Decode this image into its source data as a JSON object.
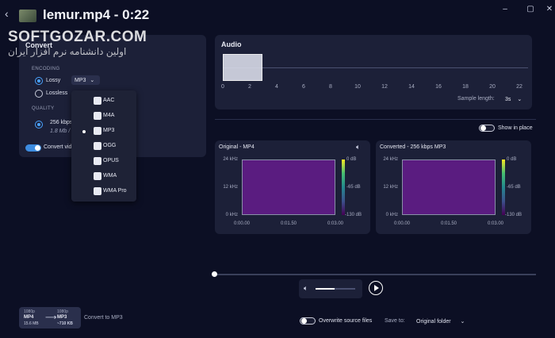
{
  "window": {
    "title": "lemur.mp4 - 0:22",
    "minimize": "–",
    "maximize": "▢",
    "close": "✕"
  },
  "watermark": {
    "main": "SOFTGOZAR.COM",
    "sub": "اولین دانشنامه نرم افزار ایران"
  },
  "convert": {
    "title": "Convert",
    "encoding_label": "ENCODING",
    "lossy_label": "Lossy",
    "lossless_label": "Lossless",
    "format_value": "MP3",
    "quality_label": "QUALITY",
    "quality_value": "256 kbps",
    "quality_size": "1.8 Mb /",
    "convert_video_label": "Convert vid"
  },
  "format_menu": [
    {
      "label": "AAC",
      "icon": "aac-icon",
      "selected": false
    },
    {
      "label": "M4A",
      "icon": "m4a-icon",
      "selected": false
    },
    {
      "label": "MP3",
      "icon": "mp3-icon",
      "selected": true
    },
    {
      "label": "OGG",
      "icon": "ogg-icon",
      "selected": false
    },
    {
      "label": "OPUS",
      "icon": "opus-icon",
      "selected": false
    },
    {
      "label": "WMA",
      "icon": "wma-icon",
      "selected": false
    },
    {
      "label": "WMA Pro",
      "icon": "wma-pro-icon",
      "selected": false
    }
  ],
  "audio": {
    "title": "Audio",
    "ticks": [
      "0",
      "2",
      "4",
      "6",
      "8",
      "10",
      "12",
      "14",
      "16",
      "18",
      "20",
      "22"
    ],
    "sample_length_label": "Sample length:",
    "sample_length_value": "3s",
    "show_in_place_label": "Show in place"
  },
  "spectrograms": {
    "original_title": "Original - MP4",
    "converted_title": "Converted - 256 kbps MP3",
    "y_labels": [
      "24 kHz",
      "12 kHz",
      "0 kHz"
    ],
    "x_labels": [
      "0:00.00",
      "0:01.50",
      "0:03.00"
    ],
    "db_labels": [
      "0 dB",
      "-65 dB",
      "-130 dB"
    ]
  },
  "summary": {
    "from_res": "1080p",
    "from_fmt": "MP4",
    "from_size": "15.6 MB",
    "to_res": "1080p",
    "to_fmt": "MP3",
    "to_size": "~710 KB",
    "convert_to": "Convert to MP3"
  },
  "footer": {
    "overwrite_label": "Overwrite source files",
    "save_to_label": "Save to:",
    "save_to_value": "Original folder"
  },
  "colors": {
    "accent": "#3d8ce0",
    "background": "#0c0f24",
    "panel": "#1c2038",
    "spectrogram_fill": "#5a1c80"
  }
}
